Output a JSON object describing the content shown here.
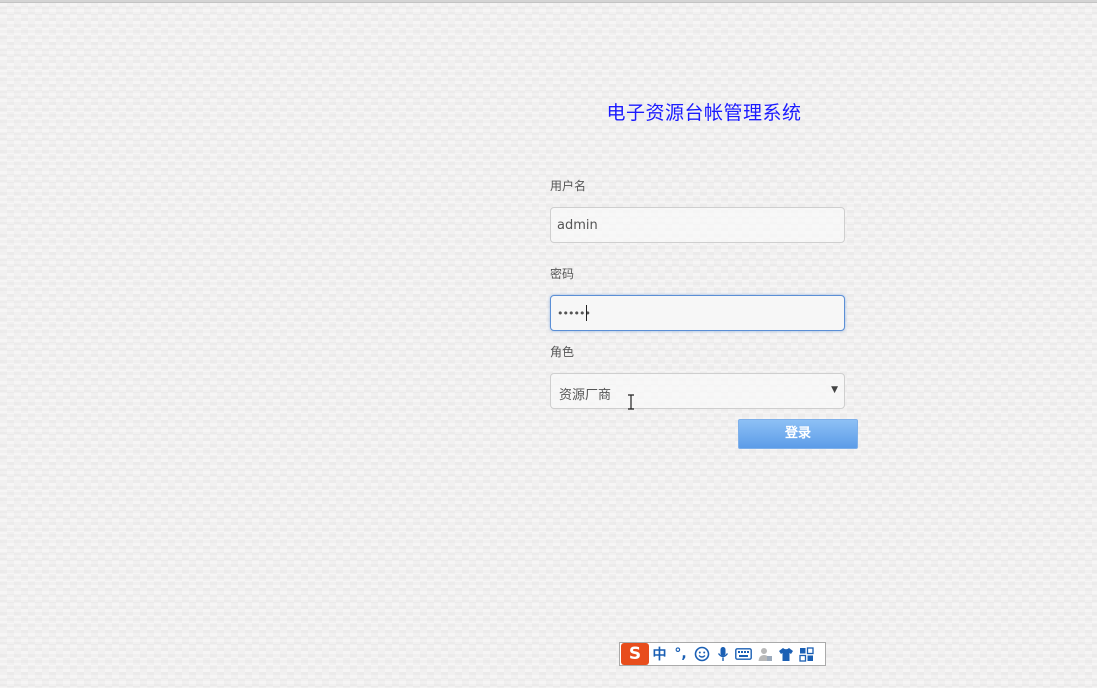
{
  "page": {
    "title": "电子资源台帐管理系统"
  },
  "form": {
    "username_label": "用户名",
    "username_value": "admin",
    "password_label": "密码",
    "password_value": "••••••",
    "role_label": "角色",
    "role_selected": "资源厂商",
    "submit_label": "登录"
  },
  "ime_toolbar": {
    "logo": "S",
    "mode": "中",
    "punctuation": "°,",
    "items": [
      "emoji-icon",
      "microphone-icon",
      "keyboard-icon",
      "user-icon",
      "skin-icon",
      "toolbox-icon"
    ]
  },
  "colors": {
    "title": "#1a1aff",
    "button": "#6aa6ee",
    "focus_border": "#5b8fd6",
    "ime_logo": "#e84d1c"
  }
}
